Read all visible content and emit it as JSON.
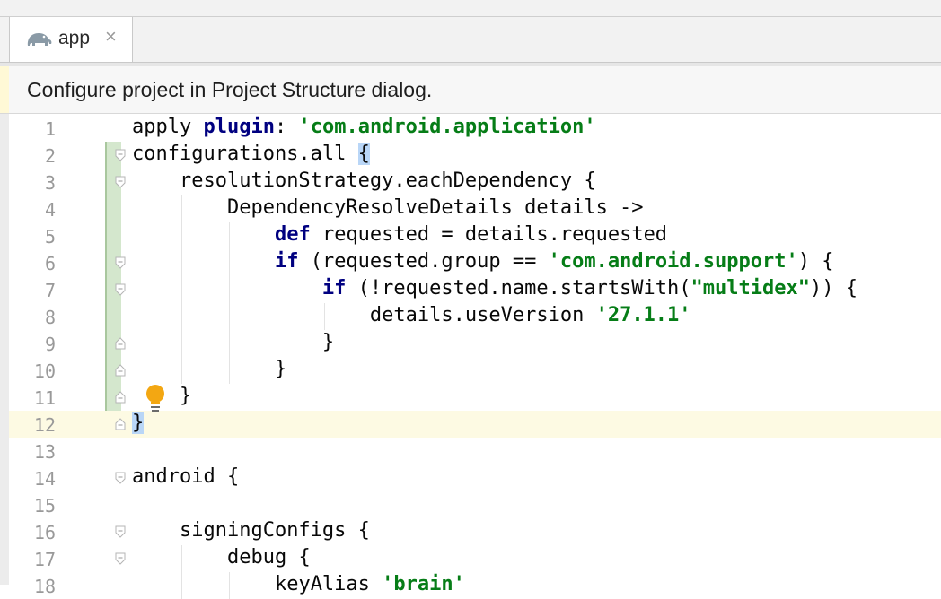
{
  "tab": {
    "label": "app",
    "icon": "elephant-icon",
    "close": "×"
  },
  "banner": {
    "text": "Configure project in Project Structure dialog."
  },
  "colors": {
    "keyword": "#000080",
    "string": "#067d17",
    "bracket_highlight": "#b9d6f7",
    "current_line": "#fdfae3",
    "vcs_changed": "#d4e7cd"
  },
  "editor": {
    "current_line": 12,
    "lines": [
      {
        "n": "1",
        "indent": 0,
        "fold": "",
        "tokens": [
          [
            "t",
            "apply "
          ],
          [
            "kw",
            "plugin"
          ],
          [
            "t",
            ": "
          ],
          [
            "str",
            "'com.android.application'"
          ]
        ]
      },
      {
        "n": "2",
        "indent": 0,
        "fold": "open",
        "tokens": [
          [
            "t",
            "configurations.all "
          ],
          [
            "hl",
            "{"
          ]
        ]
      },
      {
        "n": "3",
        "indent": 1,
        "fold": "open",
        "tokens": [
          [
            "t",
            "resolutionStrategy.eachDependency {"
          ]
        ]
      },
      {
        "n": "4",
        "indent": 2,
        "fold": "",
        "tokens": [
          [
            "t",
            "DependencyResolveDetails details ->"
          ]
        ]
      },
      {
        "n": "5",
        "indent": 3,
        "fold": "",
        "tokens": [
          [
            "kw",
            "def"
          ],
          [
            "t",
            " requested = details.requested"
          ]
        ]
      },
      {
        "n": "6",
        "indent": 3,
        "fold": "open",
        "tokens": [
          [
            "kw",
            "if"
          ],
          [
            "t",
            " (requested.group == "
          ],
          [
            "str",
            "'com.android.support'"
          ],
          [
            "t",
            ") {"
          ]
        ]
      },
      {
        "n": "7",
        "indent": 4,
        "fold": "open",
        "tokens": [
          [
            "kw",
            "if"
          ],
          [
            "t",
            " (!requested.name.startsWith("
          ],
          [
            "str",
            "\"multidex\""
          ],
          [
            "t",
            ")) {"
          ]
        ]
      },
      {
        "n": "8",
        "indent": 5,
        "fold": "",
        "tokens": [
          [
            "t",
            "details.useVersion "
          ],
          [
            "str",
            "'27.1.1'"
          ]
        ]
      },
      {
        "n": "9",
        "indent": 4,
        "fold": "end",
        "tokens": [
          [
            "t",
            "}"
          ]
        ]
      },
      {
        "n": "10",
        "indent": 3,
        "fold": "end",
        "tokens": [
          [
            "t",
            "}"
          ]
        ]
      },
      {
        "n": "11",
        "indent": 1,
        "fold": "end",
        "tokens": [
          [
            "t",
            "}"
          ]
        ]
      },
      {
        "n": "12",
        "indent": 0,
        "fold": "end",
        "tokens": [
          [
            "hl",
            "}"
          ]
        ]
      },
      {
        "n": "13",
        "indent": 0,
        "fold": "",
        "tokens": []
      },
      {
        "n": "14",
        "indent": 0,
        "fold": "open",
        "tokens": [
          [
            "t",
            "android {"
          ]
        ]
      },
      {
        "n": "15",
        "indent": 0,
        "fold": "",
        "tokens": []
      },
      {
        "n": "16",
        "indent": 1,
        "fold": "open",
        "tokens": [
          [
            "t",
            "signingConfigs {"
          ]
        ]
      },
      {
        "n": "17",
        "indent": 2,
        "fold": "open",
        "tokens": [
          [
            "t",
            "debug {"
          ]
        ]
      },
      {
        "n": "18",
        "indent": 3,
        "fold": "",
        "tokens": [
          [
            "t",
            "keyAlias "
          ],
          [
            "str",
            "'brain'"
          ]
        ]
      }
    ]
  }
}
